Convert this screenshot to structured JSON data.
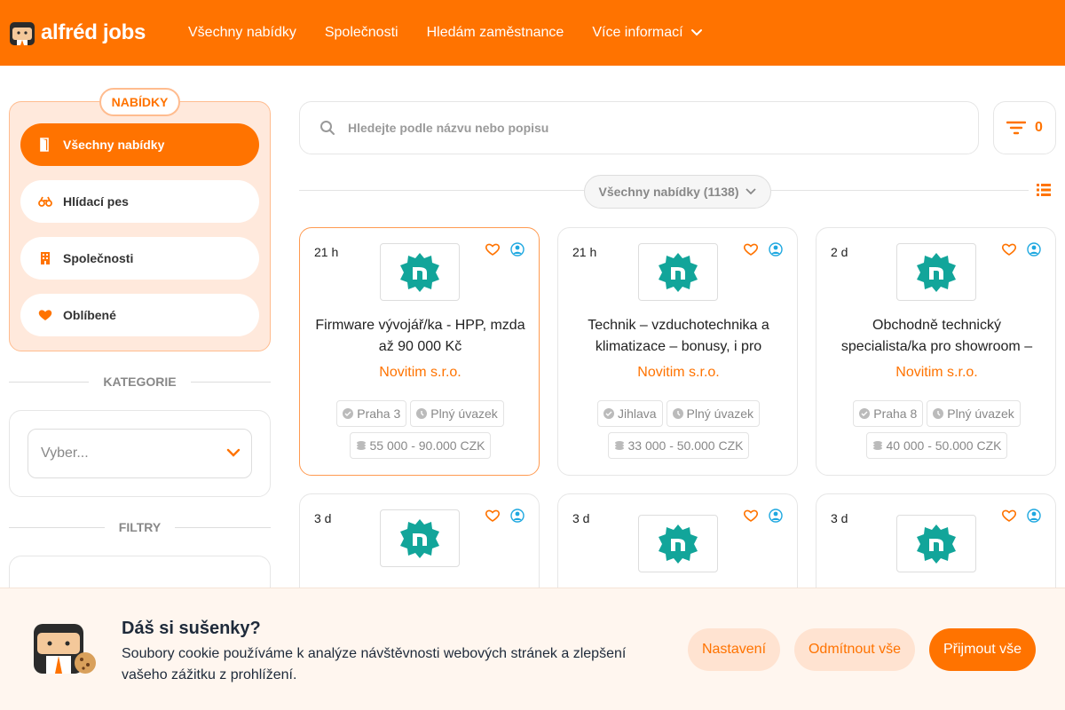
{
  "brand": {
    "name": "alfréd jobs",
    "accent": "#ff7300"
  },
  "nav": {
    "items": [
      "Všechny nabídky",
      "Společnosti",
      "Hledám zaměstnance"
    ],
    "more_label": "Více informací"
  },
  "sidebar": {
    "header_label": "NABÍDKY",
    "items": [
      {
        "label": "Všechny nabídky",
        "icon": "door-icon",
        "active": true
      },
      {
        "label": "Hlídací pes",
        "icon": "binoculars-icon",
        "active": false
      },
      {
        "label": "Společnosti",
        "icon": "building-icon",
        "active": false
      },
      {
        "label": "Oblíbené",
        "icon": "heart-icon",
        "active": false
      }
    ],
    "categories_label": "KATEGORIE",
    "categories_placeholder": "Vyber...",
    "filters_label": "FILTRY"
  },
  "search": {
    "placeholder": "Hledejte podle názvu nebo popisu"
  },
  "filter_button": {
    "count": "0"
  },
  "listing": {
    "dropdown_label": "Všechny nabídky (1138)"
  },
  "jobs": [
    {
      "age": "21 h",
      "title": "Firmware vývojář/ka - HPP, mzda až 90 000 Kč",
      "company": "Novitim s.r.o.",
      "location": "Praha 3",
      "type": "Plný úvazek",
      "salary": "55 000 - 90.000 CZK"
    },
    {
      "age": "21 h",
      "title": "Technik – vzduchotechnika a klimatizace – bonusy, i pro absolventy",
      "company": "Novitim s.r.o.",
      "location": "Jihlava",
      "type": "Plný úvazek",
      "salary": "33 000 - 50.000 CZK"
    },
    {
      "age": "2 d",
      "title": "Obchodně technický specialista/ka pro showroom – Praha",
      "company": "Novitim s.r.o.",
      "location": "Praha 8",
      "type": "Plný úvazek",
      "salary": "40 000 - 50.000 CZK"
    },
    {
      "age": "3 d"
    },
    {
      "age": "3 d"
    },
    {
      "age": "3 d"
    }
  ],
  "cookie": {
    "title": "Dáš si sušenky?",
    "text": "Soubory cookie používáme k analýze návštěvnosti webových stránek a zlepšení vašeho zážitku z prohlížení.",
    "settings_label": "Nastavení",
    "reject_label": "Odmítnout vše",
    "accept_label": "Přijmout vše"
  }
}
